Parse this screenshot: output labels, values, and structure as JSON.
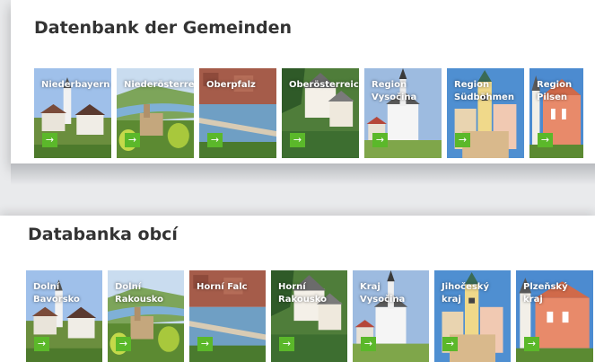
{
  "top": {
    "title": "Datenbank der Gemeinden",
    "tiles": [
      {
        "label": "Niederbayern",
        "scene": "village"
      },
      {
        "label": "Niederösterreich",
        "scene": "river"
      },
      {
        "label": "Oberpfalz",
        "scene": "bridge"
      },
      {
        "label": "Oberösterreich",
        "scene": "lake"
      },
      {
        "label": "Region Vysočina",
        "scene": "church"
      },
      {
        "label": "Region Südböhmen",
        "scene": "tower"
      },
      {
        "label": "Region Pilsen",
        "scene": "palace"
      }
    ]
  },
  "bottom": {
    "title": "Databanka obcí",
    "tiles": [
      {
        "label": "Dolní Bavorsko",
        "scene": "village"
      },
      {
        "label": "Dolní Rakousko",
        "scene": "river"
      },
      {
        "label": "Horní Falc",
        "scene": "bridge"
      },
      {
        "label": "Horní Rakousko",
        "scene": "lake"
      },
      {
        "label": "Kraj Vysočina",
        "scene": "church"
      },
      {
        "label": "Jihočeský kraj",
        "scene": "tower"
      },
      {
        "label": "Plzeňský kraj",
        "scene": "palace"
      }
    ]
  },
  "arrow_icon": "arrow-right-icon",
  "colors": {
    "accent": "#5bb82a",
    "title": "#333333"
  }
}
